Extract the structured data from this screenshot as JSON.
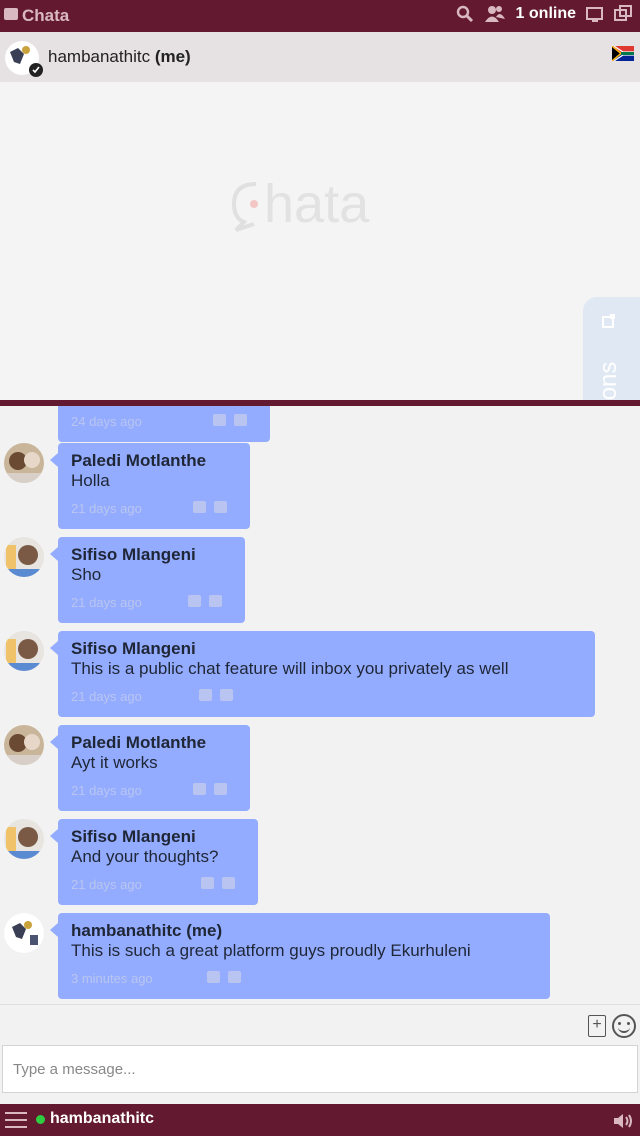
{
  "topbar": {
    "brand": "Chata",
    "online": "1 online"
  },
  "userbar": {
    "username": "hambanathitc",
    "me_suffix": "(me)"
  },
  "notifications_tab": "otifications",
  "messages": [
    {
      "name": "Paledi Motlanthe",
      "text": "Holla",
      "time": "21 days ago"
    },
    {
      "name": "Sifiso Mlangeni",
      "text": "Sho",
      "time": "21 days ago"
    },
    {
      "name": "Sifiso Mlangeni",
      "text": "This is a public chat feature will inbox you privately as well",
      "time": "21 days ago"
    },
    {
      "name": "Paledi Motlanthe",
      "text": "Ayt it works",
      "time": "21 days ago"
    },
    {
      "name": "Sifiso Mlangeni",
      "text": "And your thoughts?",
      "time": "21 days ago"
    },
    {
      "name": "hambanathitc (me)",
      "text": "This is such a great platform guys proudly Ekurhuleni",
      "time": "3 minutes ago"
    }
  ],
  "partial_message": {
    "time": "24 days ago"
  },
  "compose": {
    "placeholder": "Type a message..."
  },
  "bottombar": {
    "username": "hambanathitc"
  },
  "colors": {
    "brand": "#631a30",
    "bubble": "#93acff",
    "online_dot": "#2ecc40"
  }
}
